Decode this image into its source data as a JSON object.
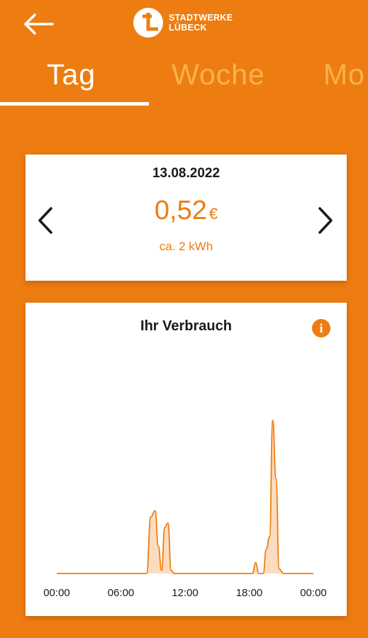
{
  "header": {
    "back_icon": "arrow-left-icon",
    "logo_line1": "STADTWERKE",
    "logo_line2": "LÜBECK"
  },
  "tabs": [
    {
      "label": "Tag",
      "active": true
    },
    {
      "label": "Woche",
      "active": false
    },
    {
      "label": "Mo",
      "active": false
    }
  ],
  "summary": {
    "date": "13.08.2022",
    "price": "0,52",
    "currency": "€",
    "energy": "ca. 2 kWh",
    "prev_icon": "chevron-left-icon",
    "next_icon": "chevron-right-icon"
  },
  "colors": {
    "accent": "#EE7D11",
    "background": "#EE7D11",
    "tab_inactive": "#F7B24A",
    "card": "#FFFFFF"
  },
  "chart": {
    "title": "Ihr Verbrauch",
    "info_label": "i",
    "info_icon": "info-icon"
  },
  "chart_data": {
    "type": "area",
    "title": "Ihr Verbrauch",
    "xlabel": "",
    "ylabel": "",
    "x_ticks": [
      "00:00",
      "06:00",
      "12:00",
      "18:00",
      "00:00"
    ],
    "xlim": [
      0,
      24
    ],
    "grid": false,
    "x": [
      0,
      6.0,
      8.4,
      8.8,
      9.2,
      9.5,
      9.8,
      10.1,
      10.4,
      10.7,
      11.0,
      18.3,
      18.6,
      18.9,
      19.3,
      19.6,
      19.9,
      20.2,
      20.5,
      20.8,
      21.2,
      24
    ],
    "y": [
      0,
      0,
      0,
      0.37,
      0.41,
      0.18,
      0.02,
      0.3,
      0.33,
      0.02,
      0,
      0,
      0.07,
      0,
      0,
      0.16,
      0.24,
      1.0,
      0.62,
      0.03,
      0,
      0
    ]
  }
}
